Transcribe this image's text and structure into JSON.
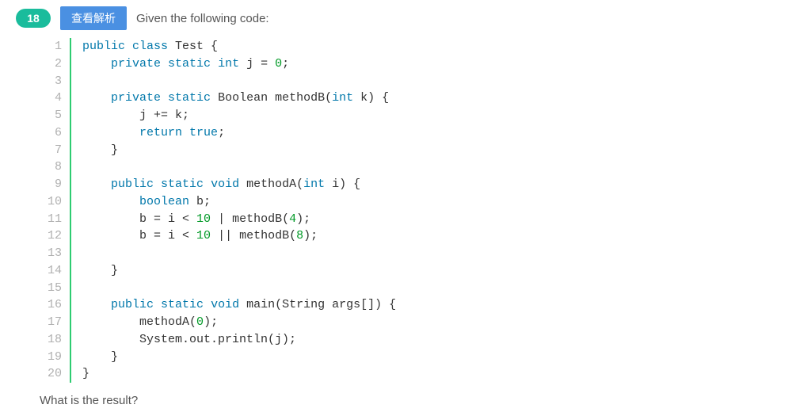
{
  "header": {
    "question_number": "18",
    "view_analysis_label": "查看解析",
    "prompt": "Given the following code:"
  },
  "code": {
    "lines": [
      [
        {
          "t": "public ",
          "c": "kw"
        },
        {
          "t": "class ",
          "c": "kw"
        },
        {
          "t": "Test {",
          "c": ""
        }
      ],
      [
        {
          "t": "    ",
          "c": ""
        },
        {
          "t": "private ",
          "c": "kw"
        },
        {
          "t": "static ",
          "c": "kw"
        },
        {
          "t": "int ",
          "c": "type"
        },
        {
          "t": "j = ",
          "c": ""
        },
        {
          "t": "0",
          "c": "num"
        },
        {
          "t": ";",
          "c": ""
        }
      ],
      [
        {
          "t": "",
          "c": ""
        }
      ],
      [
        {
          "t": "    ",
          "c": ""
        },
        {
          "t": "private ",
          "c": "kw"
        },
        {
          "t": "static ",
          "c": "kw"
        },
        {
          "t": "Boolean methodB(",
          "c": ""
        },
        {
          "t": "int ",
          "c": "type"
        },
        {
          "t": "k) {",
          "c": ""
        }
      ],
      [
        {
          "t": "        j += k;",
          "c": ""
        }
      ],
      [
        {
          "t": "        ",
          "c": ""
        },
        {
          "t": "return ",
          "c": "kw"
        },
        {
          "t": "true",
          "c": "bool"
        },
        {
          "t": ";",
          "c": ""
        }
      ],
      [
        {
          "t": "    }",
          "c": ""
        }
      ],
      [
        {
          "t": "",
          "c": ""
        }
      ],
      [
        {
          "t": "    ",
          "c": ""
        },
        {
          "t": "public ",
          "c": "kw"
        },
        {
          "t": "static ",
          "c": "kw"
        },
        {
          "t": "void ",
          "c": "kw"
        },
        {
          "t": "methodA(",
          "c": ""
        },
        {
          "t": "int ",
          "c": "type"
        },
        {
          "t": "i) {",
          "c": ""
        }
      ],
      [
        {
          "t": "        ",
          "c": ""
        },
        {
          "t": "boolean ",
          "c": "type"
        },
        {
          "t": "b;",
          "c": ""
        }
      ],
      [
        {
          "t": "        b = i < ",
          "c": ""
        },
        {
          "t": "10",
          "c": "num"
        },
        {
          "t": " | methodB(",
          "c": ""
        },
        {
          "t": "4",
          "c": "num"
        },
        {
          "t": ");",
          "c": ""
        }
      ],
      [
        {
          "t": "        b = i < ",
          "c": ""
        },
        {
          "t": "10",
          "c": "num"
        },
        {
          "t": " || methodB(",
          "c": ""
        },
        {
          "t": "8",
          "c": "num"
        },
        {
          "t": ");",
          "c": ""
        }
      ],
      [
        {
          "t": "",
          "c": ""
        }
      ],
      [
        {
          "t": "    }",
          "c": ""
        }
      ],
      [
        {
          "t": "",
          "c": ""
        }
      ],
      [
        {
          "t": "    ",
          "c": ""
        },
        {
          "t": "public ",
          "c": "kw"
        },
        {
          "t": "static ",
          "c": "kw"
        },
        {
          "t": "void ",
          "c": "kw"
        },
        {
          "t": "main(String args[]) {",
          "c": ""
        }
      ],
      [
        {
          "t": "        methodA(",
          "c": ""
        },
        {
          "t": "0",
          "c": "num"
        },
        {
          "t": ");",
          "c": ""
        }
      ],
      [
        {
          "t": "        System.out.println(j);",
          "c": ""
        }
      ],
      [
        {
          "t": "    }",
          "c": ""
        }
      ],
      [
        {
          "t": "}",
          "c": ""
        }
      ]
    ]
  },
  "footer": {
    "question": "What is the result?"
  }
}
